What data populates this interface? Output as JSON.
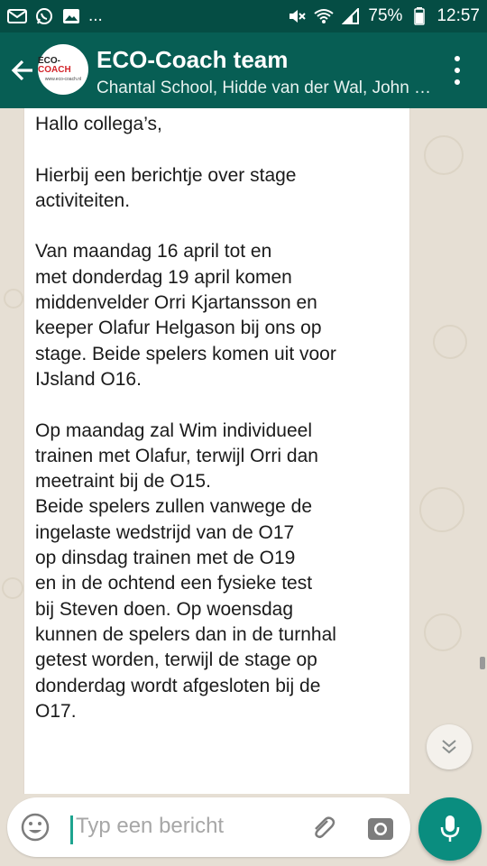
{
  "status_bar": {
    "battery": "75%",
    "time": "12:57",
    "more_indicator": "..."
  },
  "header": {
    "title": "ECO-Coach team",
    "subtitle": "Chantal School, Hidde van der Wal, John …",
    "logo_text_a": "ECO-",
    "logo_text_b": "COACH",
    "logo_url": "www.eco-coach.nl"
  },
  "message": {
    "text": "Hallo collega’s,\n\nHierbij een berichtje over stage\nactiviteiten.\n\nVan maandag 16 april tot en\nmet donderdag 19 april komen\nmiddenvelder Orri Kjartansson en\nkeeper Olafur Helgason bij ons op\nstage. Beide spelers komen uit voor\nIJsland O16.\n\nOp maandag zal Wim individueel\ntrainen met Olafur, terwijl Orri dan\nmeetraint bij de O15.\nBeide spelers zullen vanwege de\ningelaste wedstrijd van de O17\nop dinsdag trainen met de O19\nen in de ochtend een fysieke test\nbij Steven doen. Op woensdag\nkunnen de spelers dan in de turnhal\ngetest worden, terwijl de stage op\ndonderdag wordt afgesloten bij de\nO17."
  },
  "composer": {
    "placeholder": "Typ een bericht"
  },
  "icons": [
    "mail-icon",
    "whatsapp-icon",
    "image-icon",
    "mute-icon",
    "wifi-icon",
    "signal-icon",
    "battery-icon",
    "back-arrow-icon",
    "more-vert-icon",
    "scroll-down-icon",
    "emoji-icon",
    "attach-icon",
    "camera-icon",
    "mic-icon"
  ],
  "colors": {
    "header": "#075e54",
    "status_bar": "#054d44",
    "accent": "#0a8d7f",
    "wallpaper": "#e6dfd4"
  }
}
